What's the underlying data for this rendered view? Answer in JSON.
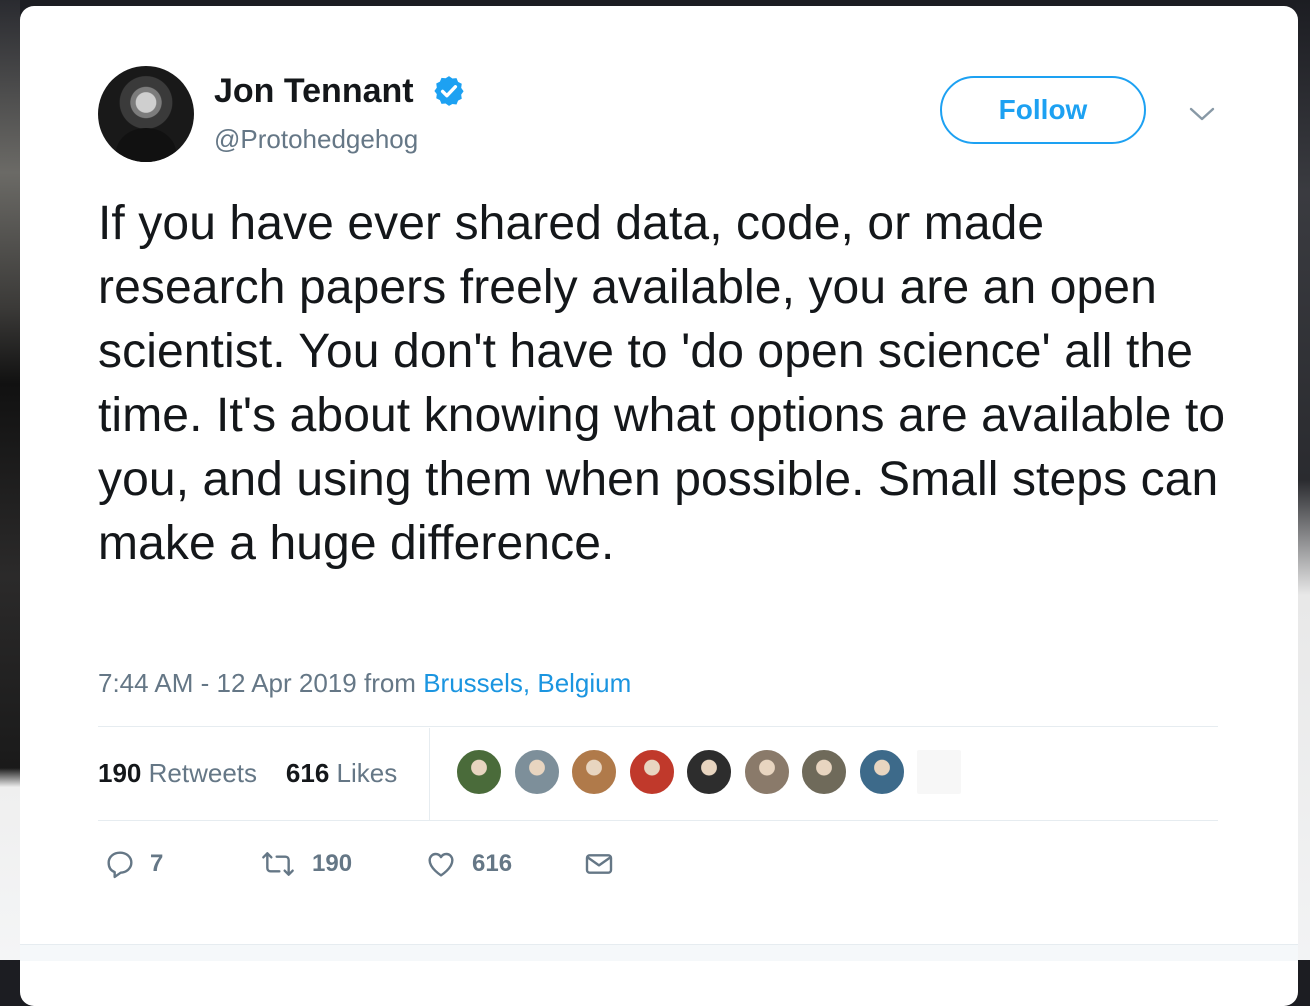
{
  "tweet": {
    "author_name": "Jon Tennant",
    "author_handle": "@Protohedgehog",
    "follow_label": "Follow",
    "text": "If you have ever shared data, code, or made research papers freely available, you are an open scientist. You don't have to 'do open science' all the time. It's about knowing what options are available to you, and using them when possible. Small steps can make a huge difference.",
    "timestamp": "7:44 AM - 12 Apr 2019",
    "from_label": "from",
    "location": "Brussels, Belgium"
  },
  "stats": {
    "retweets_count": "190",
    "retweets_label": "Retweets",
    "likes_count": "616",
    "likes_label": "Likes"
  },
  "actions": {
    "reply_count": "7",
    "retweet_count": "190",
    "like_count": "616"
  },
  "icons": {
    "verified": "verified-badge-icon",
    "caret": "chevron-down-icon",
    "reply": "reply-icon",
    "retweet": "retweet-icon",
    "like": "heart-icon",
    "dm": "envelope-icon"
  },
  "colors": {
    "accent": "#1da1f2",
    "link": "#1b95e0",
    "text": "#14171a",
    "muted": "#657786"
  },
  "liker_avatars": [
    {
      "name": "liker-avatar-1",
      "color": "#4a6b3a"
    },
    {
      "name": "liker-avatar-2",
      "color": "#7d8f9a"
    },
    {
      "name": "liker-avatar-3",
      "color": "#b07a4a"
    },
    {
      "name": "liker-avatar-4",
      "color": "#c0392b"
    },
    {
      "name": "liker-avatar-5",
      "color": "#2d2d2d"
    },
    {
      "name": "liker-avatar-6",
      "color": "#8a7a6a"
    },
    {
      "name": "liker-avatar-7",
      "color": "#6f6a5a"
    },
    {
      "name": "liker-avatar-8",
      "color": "#3d6a8a"
    },
    {
      "name": "liker-avatar-9",
      "color": "#f2f2f2"
    }
  ]
}
